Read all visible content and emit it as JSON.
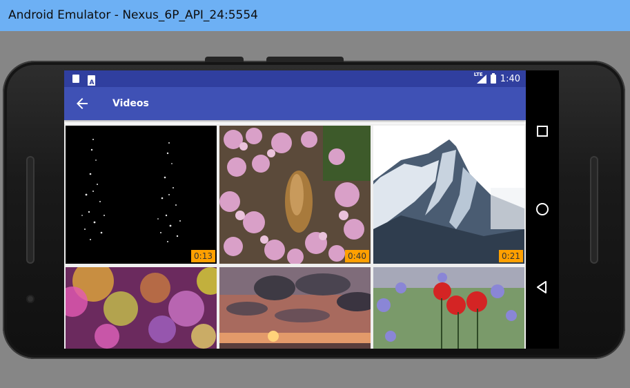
{
  "window": {
    "title": "Android Emulator - Nexus_6P_API_24:5554"
  },
  "statusbar": {
    "left_icons": [
      "sd-card-icon",
      "notification-icon"
    ],
    "right_icons": [
      "lte-signal-icon",
      "battery-icon"
    ],
    "network_label": "LTE",
    "time": "1:40"
  },
  "appbar": {
    "back_icon": "arrow-back-icon",
    "title": "Videos",
    "color": "#3f51b5",
    "status_color": "#303f9f"
  },
  "videos": [
    {
      "thumb": "water-sparkles-black",
      "duration": "0:13"
    },
    {
      "thumb": "butterfly-pink-flowers",
      "duration": "0:40"
    },
    {
      "thumb": "snowy-mountain-ridge",
      "duration": "0:21"
    },
    {
      "thumb": "bokeh-lights",
      "duration": ""
    },
    {
      "thumb": "sunset-clouds-sea",
      "duration": ""
    },
    {
      "thumb": "red-poppies-field",
      "duration": ""
    }
  ],
  "badge_color": "#ffa000",
  "navbar": {
    "buttons": [
      "recents-square-icon",
      "home-circle-icon",
      "back-triangle-icon"
    ]
  }
}
